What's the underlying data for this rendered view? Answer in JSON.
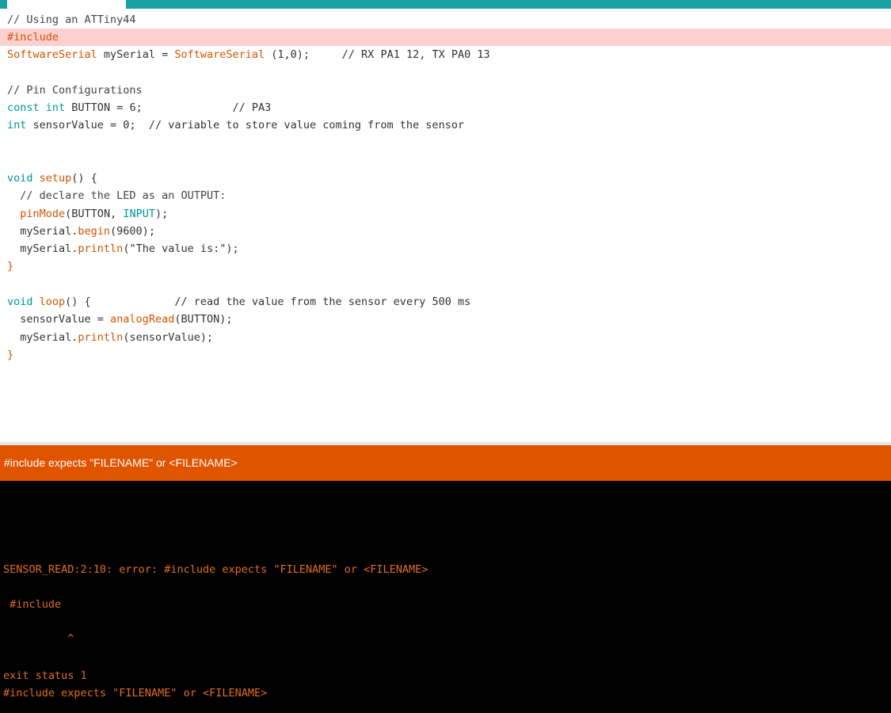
{
  "editor": {
    "lines": [
      {
        "text": "// Using an ATTiny44"
      },
      {
        "text": "#include"
      },
      {
        "type": "SoftwareSerial",
        "rest1": " mySerial = ",
        "ctor": "SoftwareSerial",
        "rest2": " (1,0);     // RX PA1 12, TX PA0 13"
      },
      {
        "text": ""
      },
      {
        "text": "// Pin Configurations"
      },
      {
        "kw1": "const",
        "kw2": "int",
        "rest": " BUTTON = 6;              // PA3"
      },
      {
        "kw": "int",
        "rest": " sensorValue = 0;  // variable to store value coming from the sensor"
      },
      {
        "text": ""
      },
      {
        "text": ""
      },
      {
        "kw": "void",
        "fn": "setup",
        "rest": "() {"
      },
      {
        "text": "  // declare the LED as an OUTPUT:"
      },
      {
        "indent": "  ",
        "fn": "pinMode",
        "mid": "(BUTTON, ",
        "kw": "INPUT",
        "rest": ");"
      },
      {
        "indent": "  mySerial.",
        "fn": "begin",
        "rest": "(9600);"
      },
      {
        "indent": "  mySerial.",
        "fn": "println",
        "rest": "(\"The value is:\");"
      },
      {
        "text": "}"
      },
      {
        "text": ""
      },
      {
        "kw": "void",
        "fn": "loop",
        "rest": "() {             // read the value from the sensor every 500 ms"
      },
      {
        "indent": "  sensorValue = ",
        "fn": "analogRead",
        "rest": "(BUTTON);"
      },
      {
        "indent": "  mySerial.",
        "fn": "println",
        "rest": "(sensorValue);"
      },
      {
        "text": "}"
      }
    ]
  },
  "status": {
    "message": "#include expects \"FILENAME\" or <FILENAME>"
  },
  "console": {
    "line1": "SENSOR_READ:2:10: error: #include expects \"FILENAME\" or <FILENAME>",
    "line2": " #include",
    "line3": "          ^",
    "line4": "exit status 1",
    "line5": "#include expects \"FILENAME\" or <FILENAME>"
  },
  "colors": {
    "tab_bar": "#17a1a5",
    "status_bar": "#e05400",
    "console_bg": "#000000",
    "console_text": "#e16e1e",
    "error_line_highlight": "#fdd0d0",
    "keyword": "#00979c",
    "function": "#d35400"
  }
}
